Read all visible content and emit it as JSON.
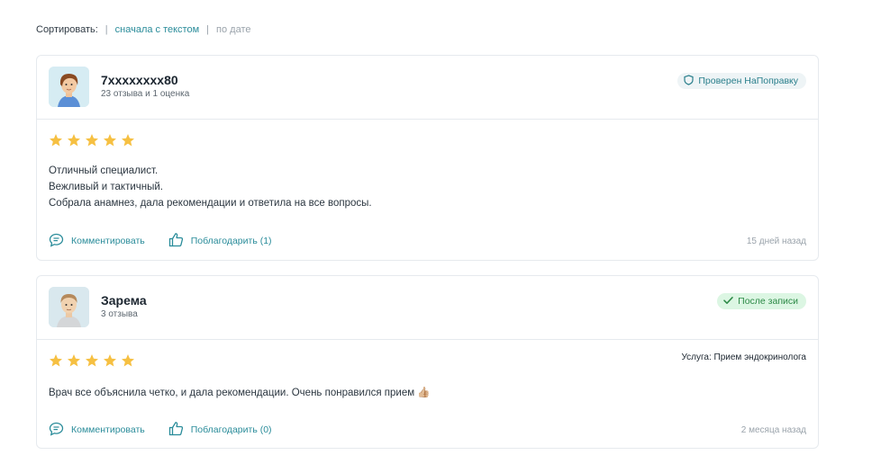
{
  "sort": {
    "label": "Сортировать:",
    "options": [
      "сначала с текстом",
      "по дате"
    ]
  },
  "reviews": [
    {
      "author": "7xxxxxxxx80",
      "author_sub": "23 отзыва и 1 оценка",
      "badge": "Проверен НаПоправку",
      "rating": 5,
      "service": "",
      "lines": [
        "Отличный специалист.",
        "Вежливый и тактичный.",
        "Собрала анамнез, дала рекомендации и ответила на все вопросы."
      ],
      "comment_label": "Комментировать",
      "thank_label": "Поблагодарить (1)",
      "date": "15 дней назад"
    },
    {
      "author": "Зарема",
      "author_sub": "3 отзыва",
      "badge": "После записи",
      "rating": 5,
      "service": "Услуга: Прием эндокринолога",
      "lines": [
        "Врач все объяснила четко, и дала рекомендации. Очень понравился прием 👍🏼"
      ],
      "comment_label": "Комментировать",
      "thank_label": "Поблагодарить (0)",
      "date": "2 месяца назад"
    }
  ],
  "colors": {
    "accent": "#2a8c9a",
    "star": "#f6c042",
    "badge_after_bg": "#dcf6e3",
    "badge_verified_bg": "#eef4f6"
  },
  "icons": {
    "comment": "speech-bubble-icon",
    "thank": "thumbs-up-icon",
    "verified": "shield-icon",
    "after": "check-icon"
  }
}
